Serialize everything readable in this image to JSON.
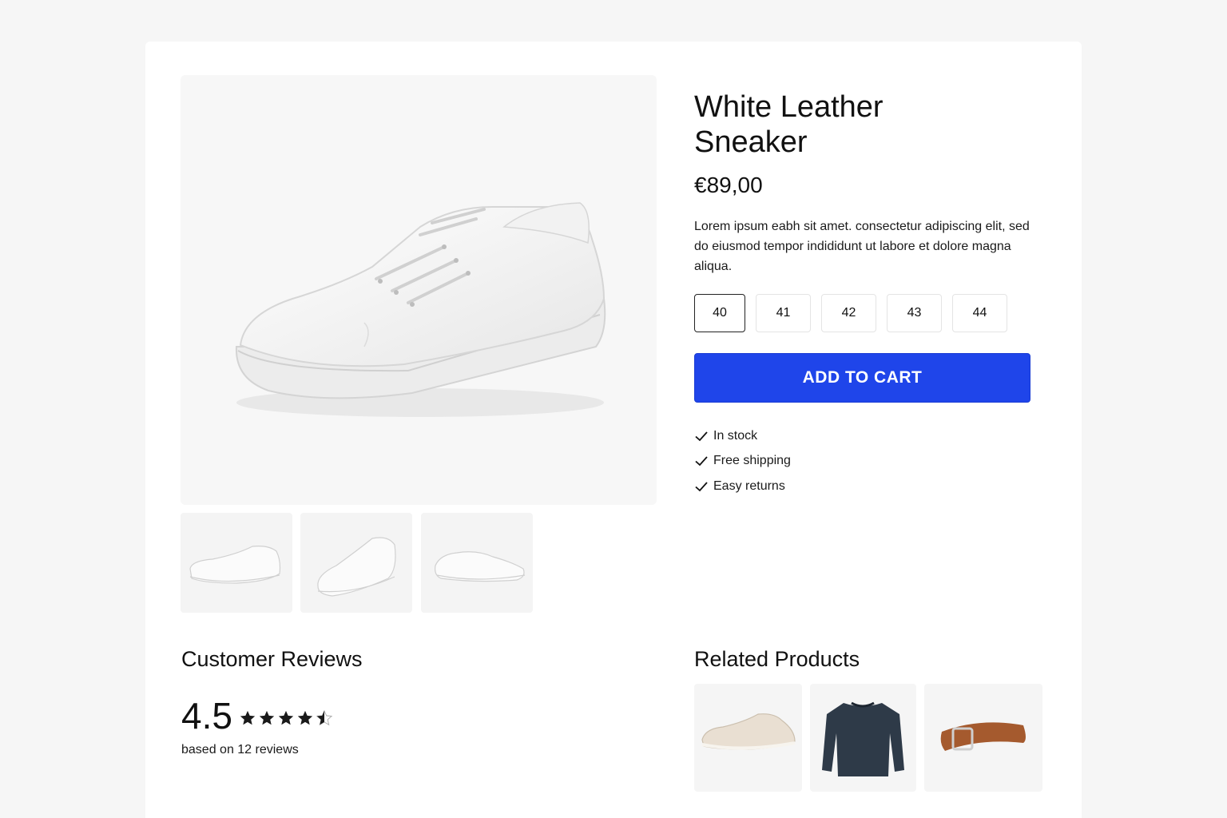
{
  "product": {
    "title": "White Leather Sneaker",
    "price": "€89,00",
    "description": "Lorem ipsum eabh sit amet.  consectetur adipiscing elit, sed do eiusmod tempor indididunt ut labore et dolore magna aliqua.",
    "sizes": [
      "40",
      "41",
      "42",
      "43",
      "44"
    ],
    "selected_size": "40",
    "add_to_cart_label": "ADD TO CART",
    "features": [
      "In stock",
      "Free shipping",
      "Easy returns"
    ]
  },
  "reviews": {
    "heading": "Customer Reviews",
    "rating": "4.5",
    "stars": 4.5,
    "count_text": "based on 12 reviews"
  },
  "related": {
    "heading": "Related Products",
    "items": [
      "beige-suede-sneaker",
      "navy-sweater",
      "brown-leather-belt"
    ]
  },
  "colors": {
    "accent": "#1f45ea",
    "text": "#111111"
  }
}
